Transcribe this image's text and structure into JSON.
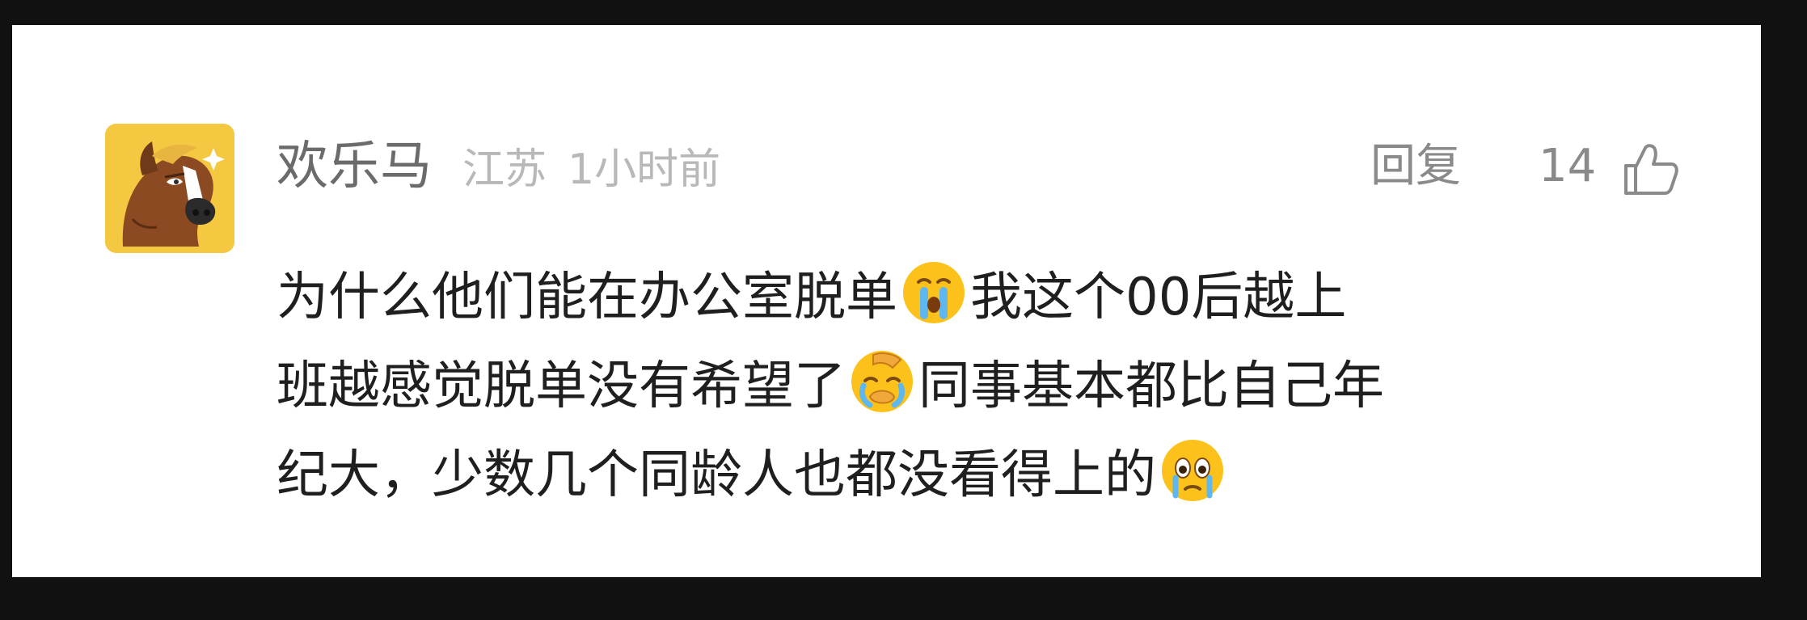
{
  "comment": {
    "username": "欢乐马",
    "location": "江苏",
    "time": "1小时前",
    "reply_label": "回复",
    "like_count": "14",
    "text_lines": [
      [
        "为什么他们能在办公室脱单",
        "crying-emoji",
        "我这个00后越上"
      ],
      [
        "班越感觉脱单没有希望了",
        "facepalm-crying-emoji",
        "同事基本都比自己年"
      ],
      [
        "纪大，少数几个同龄人也都没看得上的",
        "teary-eyed-emoji"
      ]
    ],
    "icons": {
      "avatar": "horse-avatar",
      "like": "thumbs-up-icon"
    }
  },
  "colors": {
    "page_background": "#111111",
    "card_background": "#ffffff",
    "username": "#6b6b6b",
    "meta": "#b8b8b8",
    "action": "#8a8a8a",
    "body_text": "#1f1f1f"
  }
}
